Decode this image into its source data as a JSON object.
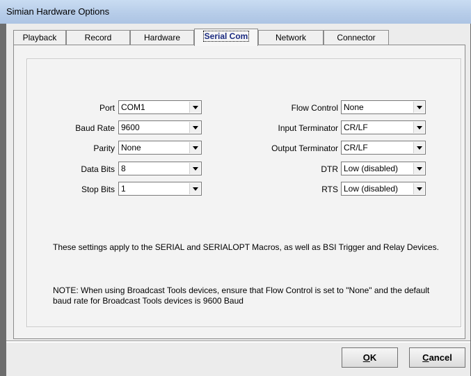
{
  "window": {
    "title": "Simian Hardware Options"
  },
  "tabs": [
    {
      "label": "Playback"
    },
    {
      "label": "Record"
    },
    {
      "label": "Hardware"
    },
    {
      "label": "Serial Com"
    },
    {
      "label": "Network"
    },
    {
      "label": "Connector"
    }
  ],
  "active_tab": "Serial Com",
  "left_fields": [
    {
      "label": "Port",
      "value": "COM1"
    },
    {
      "label": "Baud Rate",
      "value": "9600"
    },
    {
      "label": "Parity",
      "value": "None"
    },
    {
      "label": "Data Bits",
      "value": "8"
    },
    {
      "label": "Stop Bits",
      "value": "1"
    }
  ],
  "right_fields": [
    {
      "label": "Flow Control",
      "value": "None"
    },
    {
      "label": "Input Terminator",
      "value": "CR/LF"
    },
    {
      "label": "Output Terminator",
      "value": "CR/LF"
    },
    {
      "label": "DTR",
      "value": "Low (disabled)"
    },
    {
      "label": "RTS",
      "value": "Low (disabled)"
    }
  ],
  "notes": {
    "info": "These settings apply to the SERIAL and SERIALOPT Macros, as well as BSI Trigger and Relay Devices.",
    "warning": "NOTE: When using Broadcast Tools devices, ensure that Flow Control is set to \"None\" and the default baud rate for Broadcast Tools devices is 9600 Baud"
  },
  "buttons": {
    "ok_mnemonic": "O",
    "ok_rest": "K",
    "cancel_mnemonic": "C",
    "cancel_rest": "ancel"
  }
}
